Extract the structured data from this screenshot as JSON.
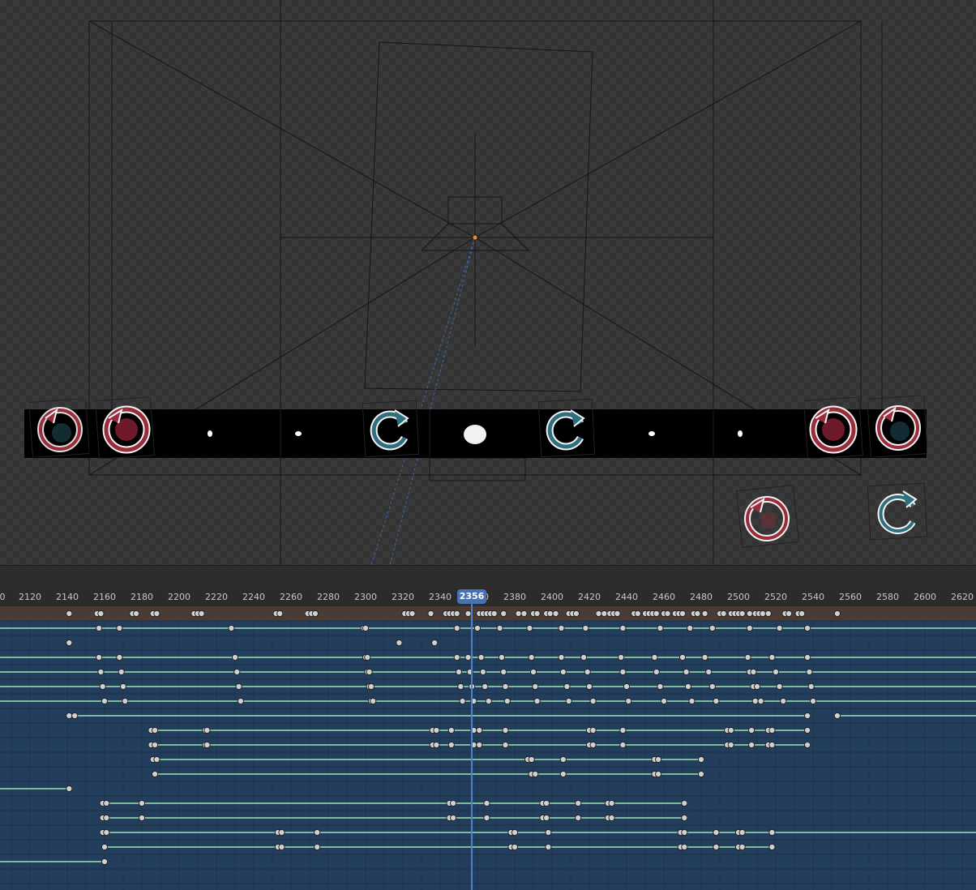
{
  "viewport": {
    "thumbnails": [
      {
        "icon": "undo-arrow-icon",
        "color": "#9b2d3b",
        "accent": "#2f6f7f"
      },
      {
        "icon": "undo-arrow-icon",
        "color": "#9b2d3b",
        "accent": "#9b2d3b"
      },
      {
        "icon": "dot-icon",
        "color": "#ffffff"
      },
      {
        "icon": "dot-icon",
        "color": "#ffffff"
      },
      {
        "icon": "redo-arrow-icon",
        "color": "#2f6f7f"
      },
      {
        "icon": "dot-icon",
        "color": "#ffffff"
      },
      {
        "icon": "redo-arrow-icon",
        "color": "#2f6f7f"
      },
      {
        "icon": "dot-icon",
        "color": "#ffffff"
      },
      {
        "icon": "dot-icon",
        "color": "#ffffff"
      },
      {
        "icon": "undo-arrow-icon",
        "color": "#9b2d3b",
        "accent": "#9b2d3b"
      },
      {
        "icon": "undo-arrow-icon",
        "color": "#9b2d3b",
        "accent": "#2f6f7f"
      }
    ],
    "loose_icons": [
      {
        "icon": "undo-arrow-icon",
        "color": "#9b2d3b"
      },
      {
        "icon": "redo-arrow-icon",
        "color": "#2f6f7f"
      }
    ]
  },
  "timeline": {
    "ticks": [
      "0",
      "2120",
      "2140",
      "2160",
      "2180",
      "2200",
      "2220",
      "2240",
      "2260",
      "2280",
      "2300",
      "2320",
      "2340",
      "2360",
      "2380",
      "2400",
      "2420",
      "2440",
      "2460",
      "2480",
      "2500",
      "2520",
      "2540",
      "2560",
      "2580",
      "2600",
      "2620"
    ],
    "current_frame": "2356",
    "colors": {
      "track_bg": "#223e5c",
      "summary_bg": "#4a3c35",
      "hold_line": "#8fd0a8",
      "playhead": "#4d80c9",
      "keyframe": "#d0d0d0"
    }
  }
}
